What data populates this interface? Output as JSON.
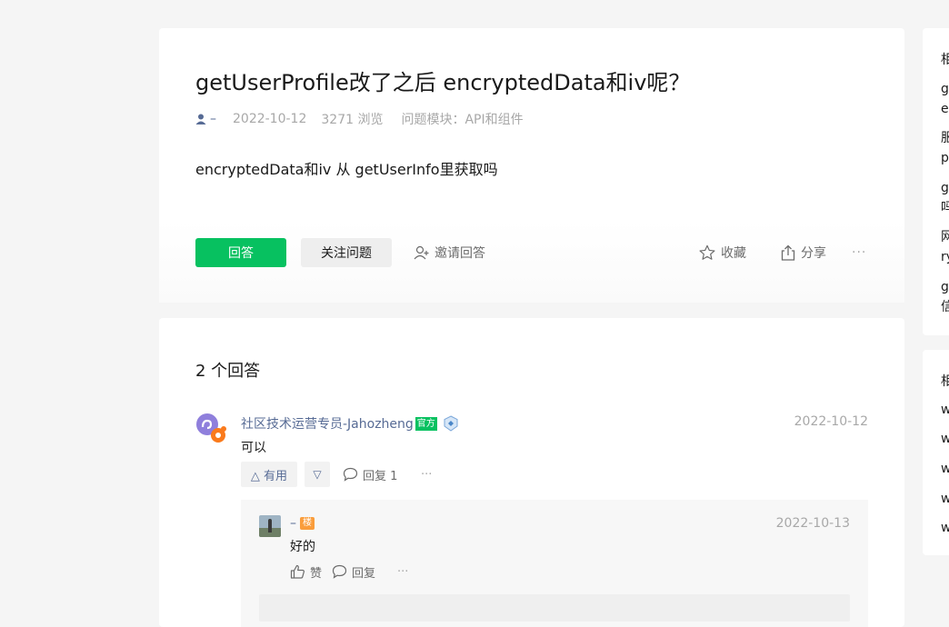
{
  "question": {
    "title": "getUserProfile改了之后 encryptedData和iv呢？",
    "author": "–",
    "date": "2022-10-12",
    "views": "3271 浏览",
    "module_label": "问题模块：",
    "module_value": "API和组件",
    "body": "encryptedData和iv 从 getUserInfo里获取吗"
  },
  "actions": {
    "answer": "回答",
    "follow": "关注问题",
    "invite": "邀请回答",
    "favorite": "收藏",
    "share": "分享",
    "more": "···"
  },
  "answers": {
    "count_label": "2 个回答",
    "first": {
      "author": "社区技术运营专员-Jahozheng",
      "official_badge": "官方",
      "date": "2022-10-12",
      "text": "可以",
      "useful": "△ 有用",
      "not_useful": "▽",
      "reply": "回复 1",
      "more": "···"
    },
    "reply": {
      "author": "–",
      "floor_badge": "楼",
      "date": "2022-10-13",
      "text": "好的",
      "like": "赞",
      "reply": "回复",
      "more": "···"
    }
  },
  "sidebar": {
    "related": {
      "head": "相",
      "items": [
        {
          "line1": "g",
          "line2": "e"
        },
        {
          "line1": "服",
          "line2": "p"
        },
        {
          "line1": "g",
          "line2": "吗"
        },
        {
          "line1": "网",
          "line2": "ry"
        },
        {
          "line1": "g",
          "line2": "信"
        }
      ]
    },
    "second": {
      "head": "相",
      "items": [
        "w",
        "w",
        "w",
        "w",
        "w"
      ]
    }
  },
  "colors": {
    "brand_green": "#07c160",
    "link_blue": "#576b95",
    "muted": "#a8a8a8",
    "floor_orange": "#fa9d3b"
  }
}
